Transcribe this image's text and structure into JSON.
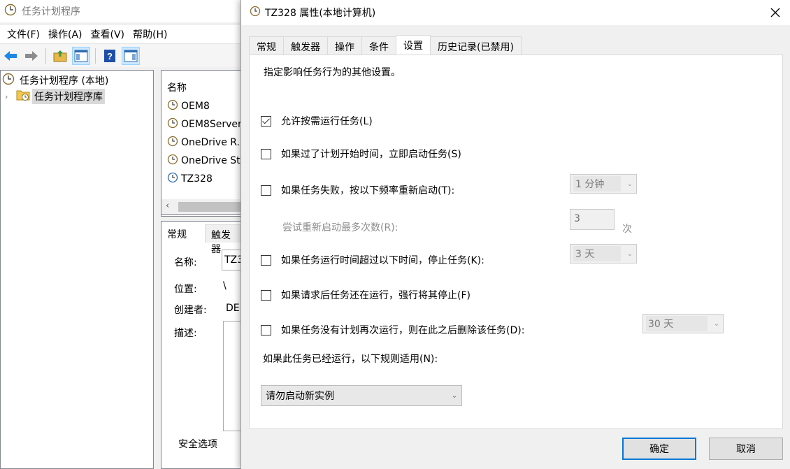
{
  "main_window": {
    "title": "任务计划程序",
    "menu": [
      "文件(F)",
      "操作(A)",
      "查看(V)",
      "帮助(H)"
    ],
    "tree": {
      "root": "任务计划程序 (本地)",
      "library": "任务计划程序库"
    },
    "task_list": {
      "header": "名称",
      "items": [
        "OEM8",
        "OEM8Server",
        "OneDrive R...",
        "OneDrive St",
        "TZ328"
      ]
    },
    "details": {
      "tabs": [
        "常规",
        "触发器"
      ],
      "name_label": "名称:",
      "name_value": "TZ3",
      "location_label": "位置:",
      "location_value": "\\",
      "author_label": "创建者:",
      "author_value": "DE",
      "description_label": "描述:",
      "security_label": "安全选项"
    }
  },
  "dialog": {
    "title": "TZ328 属性(本地计算机)",
    "tabs": [
      "常规",
      "触发器",
      "操作",
      "条件",
      "设置",
      "历史记录(已禁用)"
    ],
    "active_tab": "设置",
    "description": "指定影响任务行为的其他设置。",
    "options": [
      {
        "label": "允许按需运行任务(L)",
        "checked": true
      },
      {
        "label": "如果过了计划开始时间，立即启动任务(S)",
        "checked": false
      },
      {
        "label": "如果任务失败，按以下频率重新启动(T):",
        "checked": false
      },
      {
        "label": "如果任务运行时间超过以下时间，停止任务(K):",
        "checked": false
      },
      {
        "label": "如果请求后任务还在运行，强行将其停止(F)",
        "checked": false
      },
      {
        "label": "如果任务没有计划再次运行，则在此之后删除该任务(D):",
        "checked": false
      }
    ],
    "restart_interval": "1 分钟",
    "retry_label": "尝试重新启动最多次数(R):",
    "retry_count": "3",
    "retry_unit": "次",
    "stop_after": "3 天",
    "delete_after": "30 天",
    "rule_label": "如果此任务已经运行，以下规则适用(N):",
    "rule_value": "请勿启动新实例",
    "ok": "确定",
    "cancel": "取消"
  },
  "colors": {
    "accent": "#0078d7",
    "checkbox_border": "#333333",
    "disabled_text": "#8c8c8c"
  }
}
